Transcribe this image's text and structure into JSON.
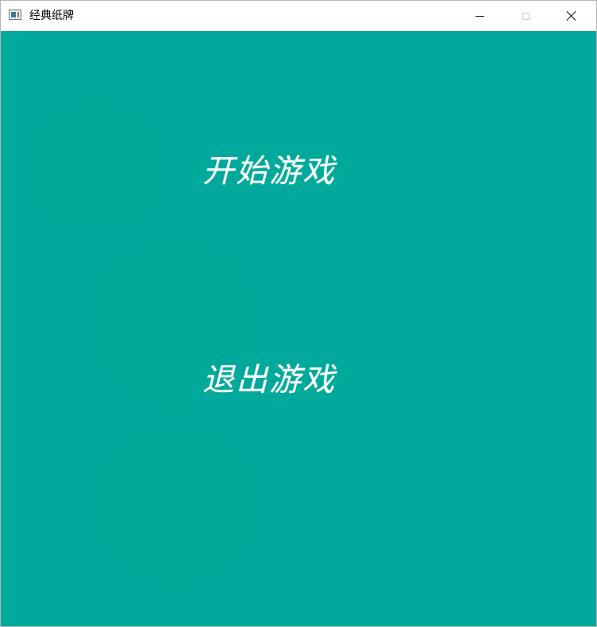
{
  "window": {
    "title": "经典纸牌",
    "icon": "window-app-icon",
    "controls": {
      "minimize_icon": "minimize-icon",
      "maximize_icon": "maximize-icon",
      "close_icon": "close-icon"
    }
  },
  "menu": {
    "start_label": "开始游戏",
    "exit_label": "退出游戏"
  },
  "colors": {
    "background": "#00a99b",
    "menu_text": "#ffffff",
    "titlebar": "#ffffff"
  }
}
